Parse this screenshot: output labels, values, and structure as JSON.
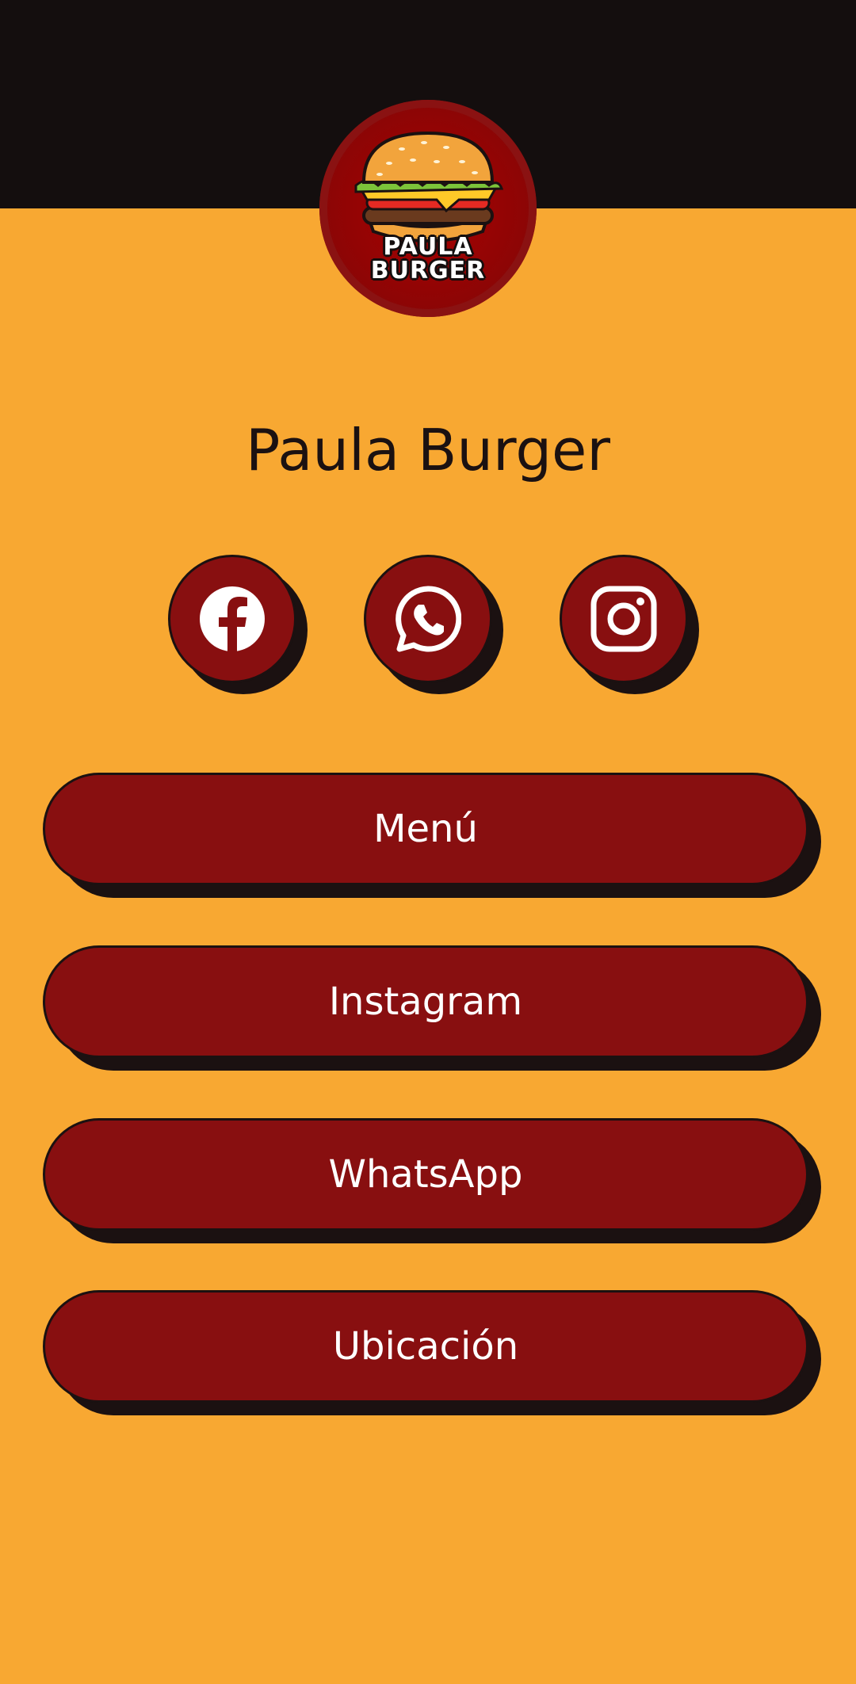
{
  "colors": {
    "background": "#F8A832",
    "header": "#140E0E",
    "button": "#880F10",
    "shadow": "#1B1111",
    "text_light": "#FFFFFF",
    "text_dark": "#1B1111"
  },
  "logo": {
    "line1": "PAULA",
    "line2": "BURGER",
    "icon": "burger-icon"
  },
  "profile": {
    "name": "Paula Burger"
  },
  "social": [
    {
      "icon": "facebook-icon"
    },
    {
      "icon": "whatsapp-icon"
    },
    {
      "icon": "instagram-icon"
    }
  ],
  "links": [
    {
      "label": "Menú"
    },
    {
      "label": "Instagram"
    },
    {
      "label": "WhatsApp"
    },
    {
      "label": "Ubicación"
    }
  ]
}
